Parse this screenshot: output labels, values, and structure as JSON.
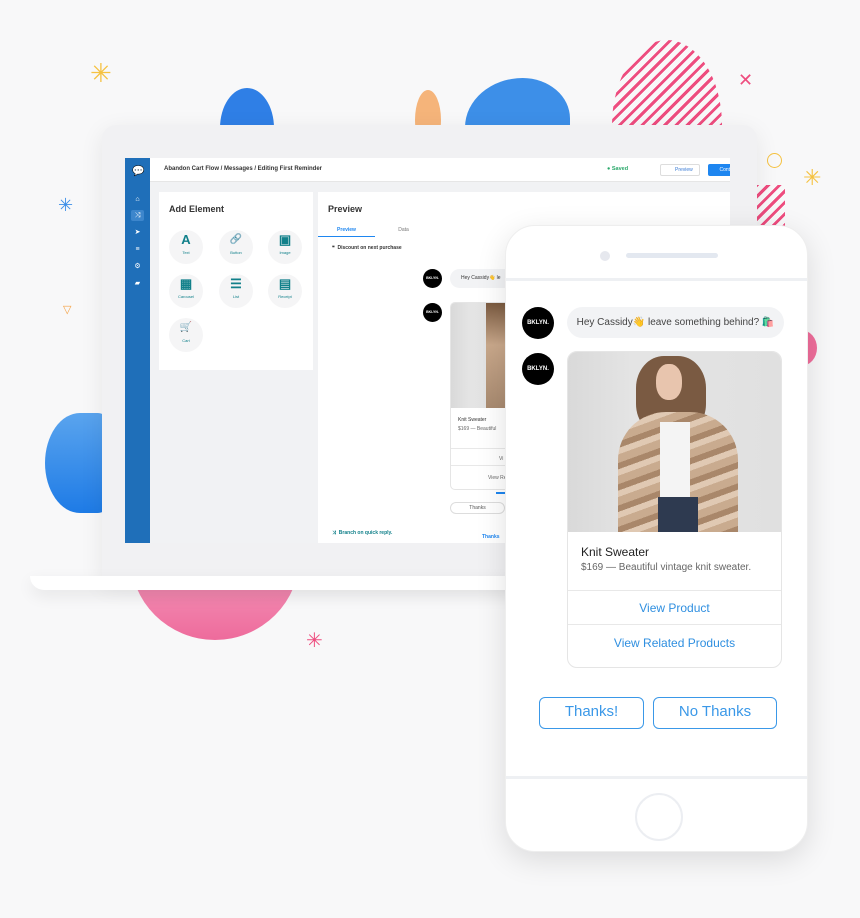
{
  "app": {
    "breadcrumb": "Abandon Cart Flow / Messages / Editing First Reminder",
    "saved": "Saved",
    "preview_button": "Preview",
    "continue_button": "Continue"
  },
  "add_element": {
    "title": "Add Element",
    "items": [
      {
        "label": "Text",
        "icon": "A"
      },
      {
        "label": "Button",
        "icon": "🔗"
      },
      {
        "label": "Image",
        "icon": "▣"
      },
      {
        "label": "Carousel",
        "icon": "▦"
      },
      {
        "label": "List",
        "icon": "☰"
      },
      {
        "label": "Receipt",
        "icon": "▤"
      },
      {
        "label": "Cart",
        "icon": "🛒"
      }
    ]
  },
  "preview": {
    "title": "Preview",
    "tabs": [
      "Preview",
      "Data"
    ],
    "discount": "Discount on next purchase",
    "greeting_short": "Hey Cassidy👋 le",
    "product_title": "Knit Sweater",
    "product_price_short": "$169 — Beautiful",
    "view_short": "Vi",
    "view_related_short": "View Re",
    "quick_reply": "Thanks",
    "branch": "Branch on quick reply.",
    "branch_link": "Thanks"
  },
  "phone": {
    "brand": "BKLYN.",
    "greeting": "Hey Cassidy👋 leave something behind? 🛍️",
    "product_title": "Knit Sweater",
    "product_desc": "$169 — Beautiful vintage knit sweater.",
    "view_product": "View Product",
    "view_related": "View Related Products",
    "quick_replies": [
      "Thanks!",
      "No Thanks"
    ]
  },
  "colors": {
    "accent": "#1e86f0",
    "sidebar": "#1f6fb9",
    "teal": "#11808a",
    "pink": "#ef5b8f",
    "reply": "#3a98e8"
  }
}
